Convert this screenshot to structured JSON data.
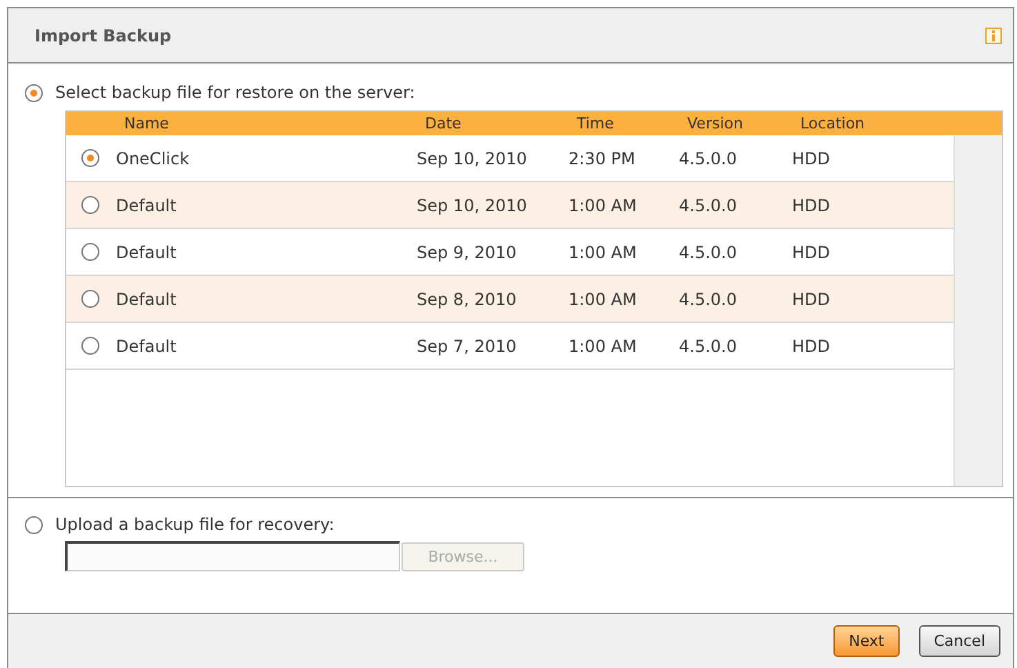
{
  "dialog": {
    "title": "Import Backup"
  },
  "options": [
    {
      "label": "Select backup file for restore on the server:",
      "selected": true
    },
    {
      "label": "Upload a backup file for recovery:",
      "selected": false
    }
  ],
  "table": {
    "columns": [
      "Name",
      "Date",
      "Time",
      "Version",
      "Location"
    ],
    "rows": [
      {
        "selected": true,
        "cells": [
          "OneClick",
          "Sep 10, 2010",
          "2:30 PM",
          "4.5.0.0",
          "HDD"
        ]
      },
      {
        "selected": false,
        "cells": [
          "Default",
          "Sep 10, 2010",
          "1:00 AM",
          "4.5.0.0",
          "HDD"
        ]
      },
      {
        "selected": false,
        "cells": [
          "Default",
          "Sep 9, 2010",
          "1:00 AM",
          "4.5.0.0",
          "HDD"
        ]
      },
      {
        "selected": false,
        "cells": [
          "Default",
          "Sep 8, 2010",
          "1:00 AM",
          "4.5.0.0",
          "HDD"
        ]
      },
      {
        "selected": false,
        "cells": [
          "Default",
          "Sep 7, 2010",
          "1:00 AM",
          "4.5.0.0",
          "HDD"
        ]
      }
    ]
  },
  "upload": {
    "browse": {
      "label": "Browse...",
      "disabled": true
    }
  },
  "buttons": [
    {
      "label": "Next",
      "kind": "primary"
    },
    {
      "label": "Cancel",
      "kind": "secondary"
    }
  ]
}
